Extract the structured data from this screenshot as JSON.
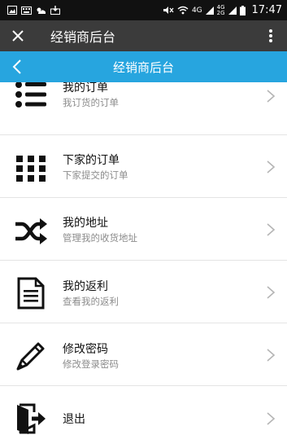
{
  "status_bar": {
    "network_1": "4G",
    "network_2": "4G",
    "network_2_sub": "2G",
    "time": "17:47"
  },
  "titlebar": {
    "title": "经销商后台",
    "close_icon": "close-icon",
    "menu_icon": "more-vertical-icon"
  },
  "header": {
    "title": "经销商后台",
    "back_icon": "chevron-left-icon",
    "color": "#27a5df"
  },
  "menu": [
    {
      "title": "我的订单",
      "subtitle": "我订货的订单",
      "icon": "list-icon"
    },
    {
      "title": "下家的订单",
      "subtitle": "下家提交的订单",
      "icon": "grid-icon"
    },
    {
      "title": "我的地址",
      "subtitle": "管理我的收货地址",
      "icon": "shuffle-icon"
    },
    {
      "title": "我的返利",
      "subtitle": "查看我的返利",
      "icon": "document-icon"
    },
    {
      "title": "修改密码",
      "subtitle": "修改登录密码",
      "icon": "pencil-icon"
    },
    {
      "title": "退出",
      "subtitle": "",
      "icon": "logout-icon"
    }
  ]
}
